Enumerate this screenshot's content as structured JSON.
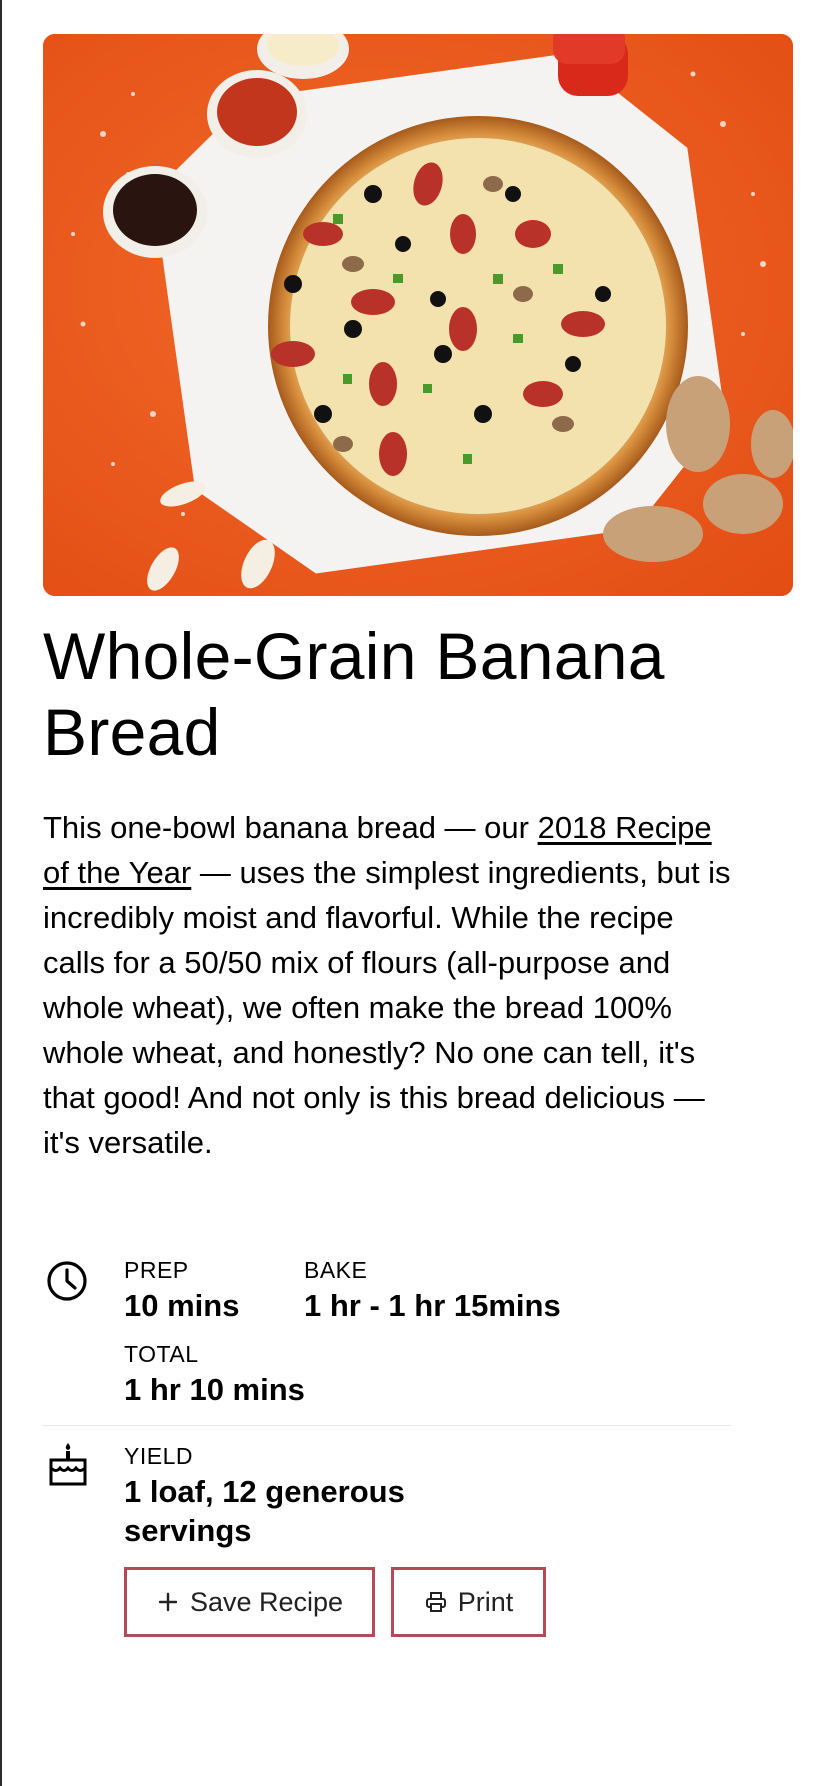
{
  "recipe": {
    "title": "Whole-Grain Banana Bread",
    "description": {
      "part1": "This one-bowl banana bread — our ",
      "link_text": "2018 Recipe of the Year",
      "part2": " — uses the simplest ingredients, but is incredibly moist and flavorful. While the recipe calls for a 50/50 mix of flours (all-purpose and whole wheat), we often make the bread 100% whole wheat, and honestly? No one can tell, it's that good! And not only is this bread delicious — it's versatile."
    },
    "times": {
      "prep_label": "PREP",
      "prep_value": "10 mins",
      "bake_label": "BAKE",
      "bake_value": "1 hr - 1 hr 15mins",
      "total_label": "TOTAL",
      "total_value": "1 hr 10 mins"
    },
    "yield": {
      "label": "YIELD",
      "value": "1 loaf, 12 generous servings"
    }
  },
  "actions": {
    "save_label": "Save Recipe",
    "print_label": "Print"
  },
  "icons": {
    "time": "clock-icon",
    "yield": "cake-icon",
    "save": "plus-icon",
    "print": "printer-icon"
  },
  "colors": {
    "button_border": "#b54a57",
    "hero_background": "#ee5a1b"
  }
}
